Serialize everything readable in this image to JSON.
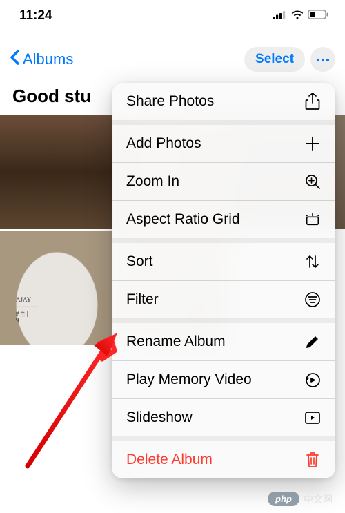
{
  "status": {
    "time": "11:24"
  },
  "nav": {
    "back_label": "Albums",
    "select_label": "Select"
  },
  "album": {
    "title": "Good stu"
  },
  "menu": {
    "items": [
      {
        "label": "Share Photos",
        "icon": "share-icon",
        "destructive": false,
        "group_end": true
      },
      {
        "label": "Add Photos",
        "icon": "plus-icon",
        "destructive": false,
        "group_end": false
      },
      {
        "label": "Zoom In",
        "icon": "zoom-in-icon",
        "destructive": false,
        "group_end": false
      },
      {
        "label": "Aspect Ratio Grid",
        "icon": "aspect-ratio-icon",
        "destructive": false,
        "group_end": true
      },
      {
        "label": "Sort",
        "icon": "sort-icon",
        "destructive": false,
        "group_end": false
      },
      {
        "label": "Filter",
        "icon": "filter-icon",
        "destructive": false,
        "group_end": true
      },
      {
        "label": "Rename Album",
        "icon": "pencil-icon",
        "destructive": false,
        "group_end": false
      },
      {
        "label": "Play Memory Video",
        "icon": "memory-icon",
        "destructive": false,
        "group_end": false
      },
      {
        "label": "Slideshow",
        "icon": "slideshow-icon",
        "destructive": false,
        "group_end": true
      },
      {
        "label": "Delete Album",
        "icon": "trash-icon",
        "destructive": true,
        "group_end": false
      }
    ]
  },
  "watermark": {
    "badge": "php",
    "label": "中文网"
  }
}
